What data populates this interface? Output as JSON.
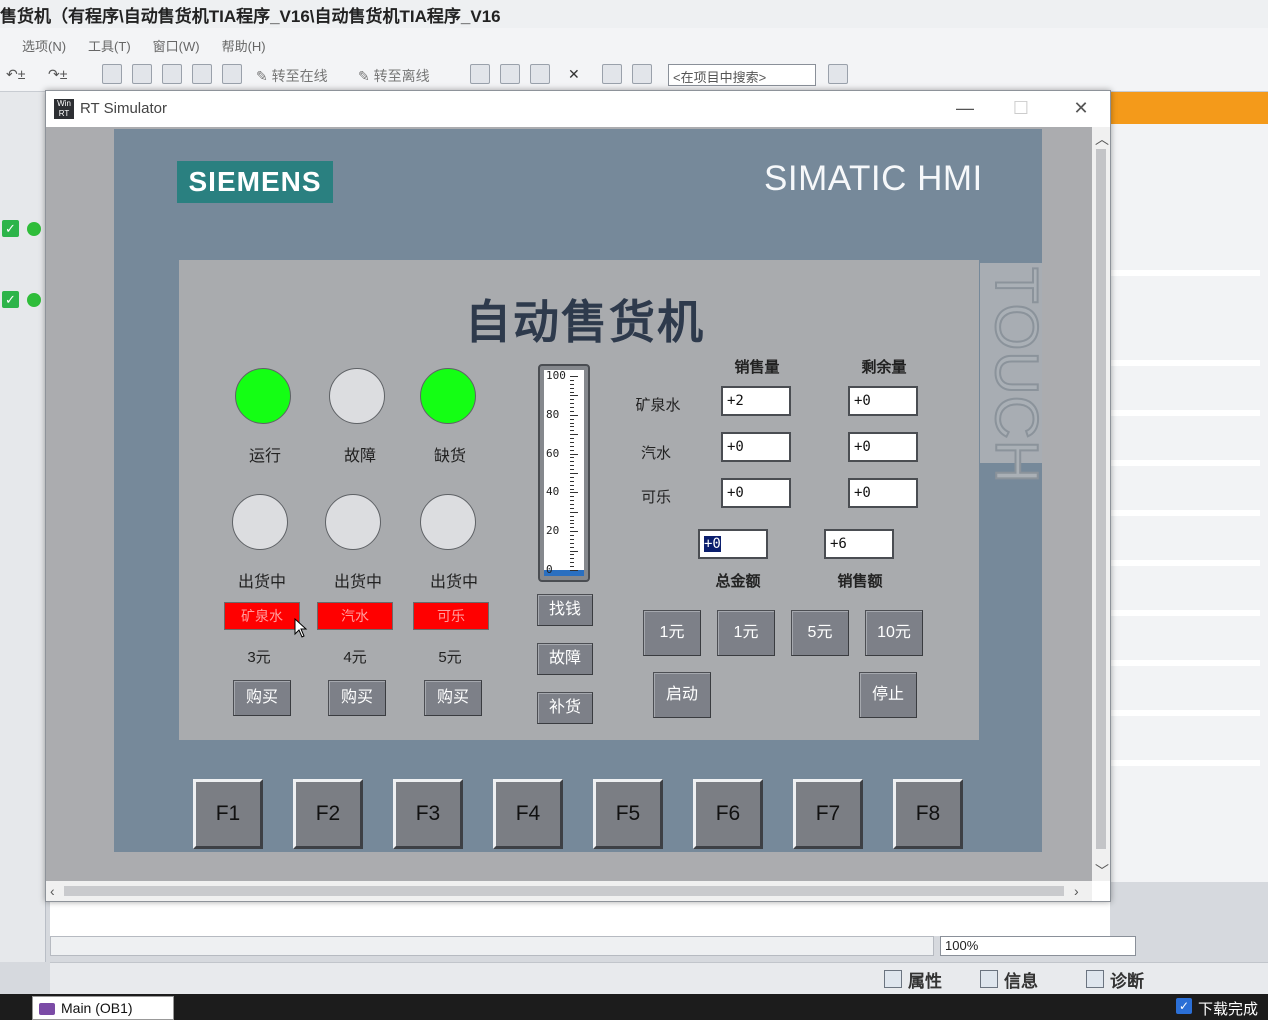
{
  "tia": {
    "title": "售货机（有程序\\自动售货机TIA程序_V16\\自动售货机TIA程序_V16",
    "menu": [
      "选项(N)",
      "工具(T)",
      "窗口(W)",
      "帮助(H)"
    ],
    "toolbar": {
      "go_online": "转至在线",
      "go_offline": "转至离线",
      "search_placeholder": "<在项目中搜索>"
    },
    "zoom": "100%",
    "bottom_tabs": [
      "属性",
      "信息",
      "诊断"
    ],
    "taskbar_tab": "Main (OB1)",
    "status": "下载完成"
  },
  "simulator": {
    "title": "RT Simulator",
    "hmi": {
      "brand": "SIEMENS",
      "model": "SIMATIC HMI",
      "touch": "TOUCH",
      "screen": {
        "title": "自动售货机",
        "lamps_top": [
          {
            "label": "运行",
            "state": "on"
          },
          {
            "label": "故障",
            "state": "off"
          },
          {
            "label": "缺货",
            "state": "on"
          }
        ],
        "lamps_bottom": [
          {
            "label": "出货中",
            "state": "off"
          },
          {
            "label": "出货中",
            "state": "off"
          },
          {
            "label": "出货中",
            "state": "off"
          }
        ],
        "products": [
          {
            "alarm": "矿泉水",
            "price": "3元",
            "buy": "购买"
          },
          {
            "alarm": "汽水",
            "price": "4元",
            "buy": "购买"
          },
          {
            "alarm": "可乐",
            "price": "5元",
            "buy": "购买"
          }
        ],
        "gauge": {
          "ticks": [
            "100",
            "80",
            "60",
            "40",
            "20",
            "0"
          ],
          "level_percent": 3
        },
        "center_buttons": [
          "找钱",
          "故障",
          "补货"
        ],
        "table": {
          "col_sales": "销售量",
          "col_remain": "剩余量",
          "rows": [
            {
              "name": "矿泉水",
              "sales": "+2",
              "remain": "+0"
            },
            {
              "name": "汽水",
              "sales": "+0",
              "remain": "+0"
            },
            {
              "name": "可乐",
              "sales": "+0",
              "remain": "+0"
            }
          ]
        },
        "total_amount": {
          "value": "+0",
          "label": "总金额"
        },
        "sales_amount": {
          "value": "+6",
          "label": "销售额"
        },
        "coin_buttons": [
          "1元",
          "1元",
          "5元",
          "10元"
        ],
        "start": "启动",
        "stop": "停止"
      },
      "function_keys": [
        "F1",
        "F2",
        "F3",
        "F4",
        "F5",
        "F6",
        "F7",
        "F8"
      ]
    }
  },
  "colors": {
    "lamp_on": "#14ff14",
    "alarm_red": "#ff0000",
    "panel": "#76899a",
    "brand": "#2a8080",
    "orange_accent": "#f49a1a"
  },
  "icons": [
    "undo-icon",
    "redo-icon",
    "search-icon",
    "minimize-icon",
    "maximize-icon",
    "close-icon",
    "check-icon",
    "mouse-cursor-icon"
  ]
}
